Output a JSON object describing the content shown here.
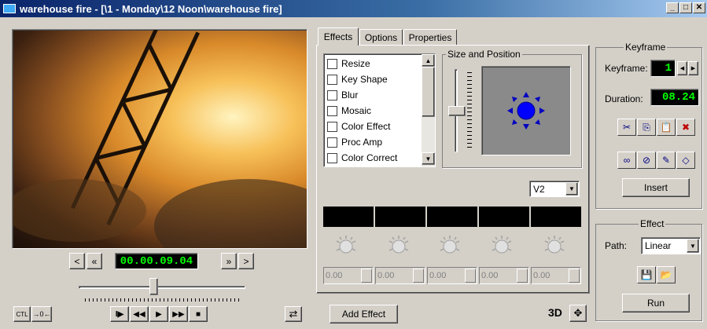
{
  "window": {
    "title": "warehouse fire - [\\1 - Monday\\12 Noon\\warehouse fire]",
    "min": "_",
    "max": "□",
    "close": "✕"
  },
  "player": {
    "timecode": "00.00.09.04",
    "prev_label": "<",
    "rewind_label": "«",
    "ffwd_label": "»",
    "next_label": ">",
    "ctl_label": "CTL",
    "goto_label": "→0←",
    "loop_label": "⇄",
    "slider_position": 0.45
  },
  "transport": [
    "I▶",
    "◀◀",
    "▶",
    "▶▶",
    "■"
  ],
  "tabs": [
    {
      "label": "Effects"
    },
    {
      "label": "Options"
    },
    {
      "label": "Properties"
    }
  ],
  "effects": [
    {
      "label": "Resize"
    },
    {
      "label": "Key Shape"
    },
    {
      "label": "Blur"
    },
    {
      "label": "Mosaic"
    },
    {
      "label": "Color Effect"
    },
    {
      "label": "Proc Amp"
    },
    {
      "label": "Color Correct"
    }
  ],
  "size_position": {
    "label": "Size and Position"
  },
  "track": {
    "value": "V2"
  },
  "spinners": [
    "0.00",
    "0.00",
    "0.00",
    "0.00",
    "0.00"
  ],
  "add_effect_label": "Add Effect",
  "btn_3d_label": "3D",
  "keyframe": {
    "group_label": "Keyframe",
    "keyframe_label": "Keyframe:",
    "keyframe_value": "1",
    "duration_label": "Duration:",
    "duration_value": "08.24",
    "insert_label": "Insert"
  },
  "effect_panel": {
    "group_label": "Effect",
    "path_label": "Path:",
    "path_value": "Linear",
    "run_label": "Run"
  },
  "colors": {
    "lcd_green": "#00ff00",
    "title_blue": "#0a246a",
    "dot_blue": "#0000ff"
  }
}
